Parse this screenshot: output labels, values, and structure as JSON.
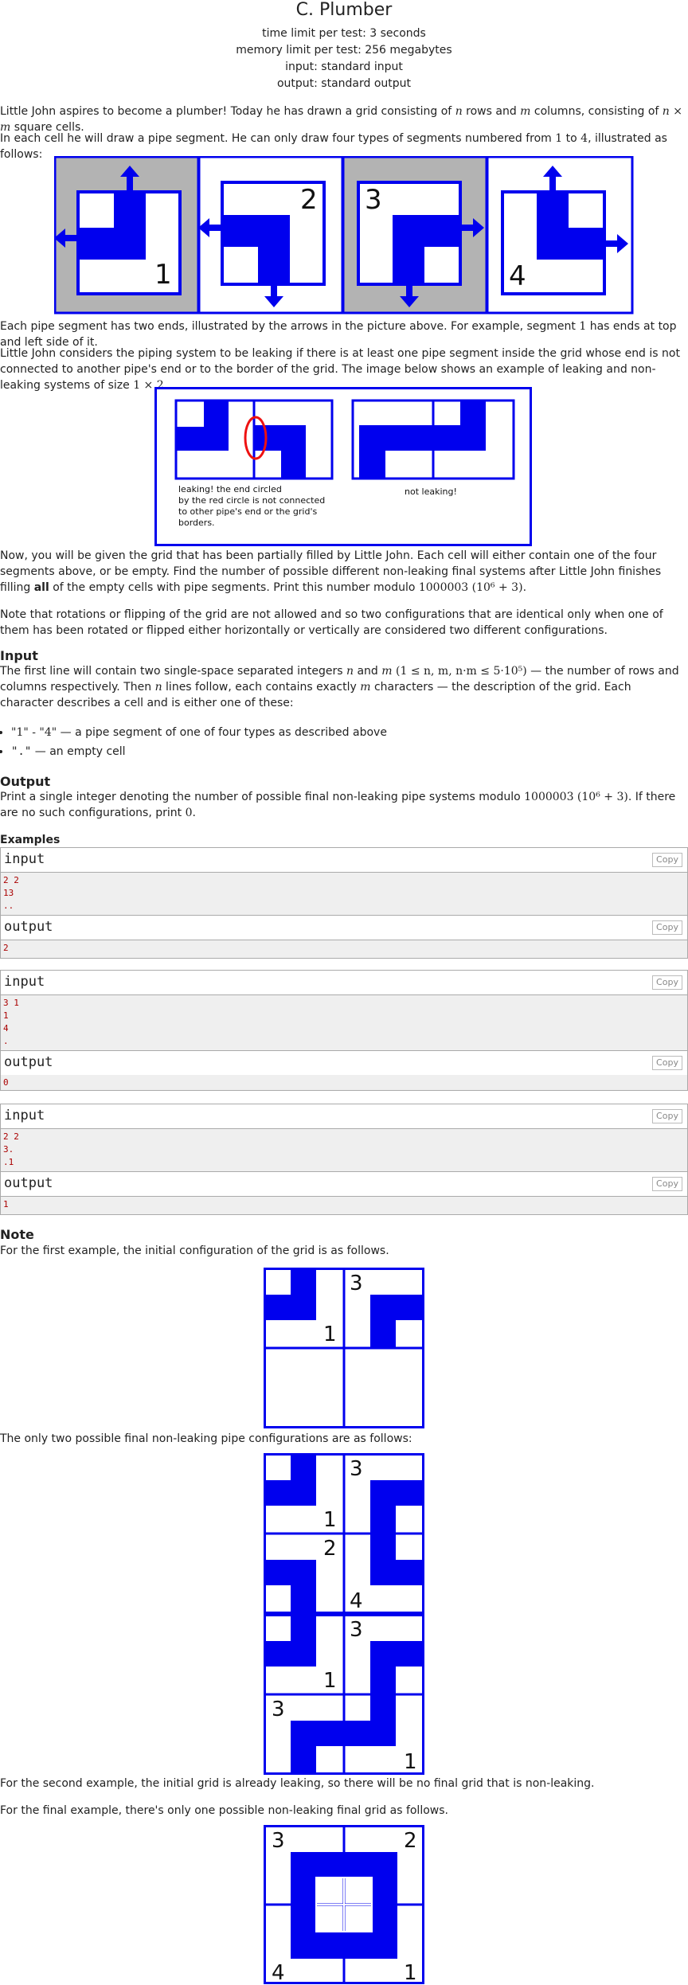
{
  "header": {
    "title": "C. Plumber",
    "time_limit": "time limit per test: 3 seconds",
    "memory_limit": "memory limit per test: 256 megabytes",
    "input": "input: standard input",
    "output": "output: standard output"
  },
  "statement": {
    "p1a": "Little John aspires to become a plumber! Today he has drawn a grid consisting of ",
    "p1n": "n",
    "p1b": " rows and ",
    "p1m": "m",
    "p1c": " columns, consisting of ",
    "p1nm": "n × m",
    "p1d": " square cells.",
    "p2a": "In each cell he will draw a pipe segment. He can only draw four types of segments numbered from ",
    "p2one": "1",
    "p2b": " to ",
    "p2four": "4",
    "p2c": ", illustrated as follows:",
    "p3a": "Each pipe segment has two ends, illustrated by the arrows in the picture above. For example, segment ",
    "p3one": "1",
    "p3b": " has ends at top and left side of it.",
    "p4a": "Little John considers the piping system to be leaking if there is at least one pipe segment inside the grid whose end is not connected to another pipe's end or to the border of the grid. The image below shows an example of leaking and non-leaking systems of size ",
    "p4size": "1 × 2",
    "p4b": ".",
    "p5a": "Now, you will be given the grid that has been partially filled by Little John. Each cell will either contain one of the four segments above, or be empty. Find the number of possible different non-leaking final systems after Little John finishes filling ",
    "p5all": "all",
    "p5b": " of the empty cells with pipe segments. Print this number modulo ",
    "p5mod": "1000003 (10⁶ + 3)",
    "p5c": ".",
    "p6": "Note that rotations or flipping of the grid are not allowed and so two configurations that are identical only when one of them has been rotated or flipped either horizontally or vertically are considered two different configurations."
  },
  "pipes": [
    "1",
    "2",
    "3",
    "4"
  ],
  "leak_figure": {
    "caption_left": [
      "leaking! the end circled",
      "by the red circle is not connected",
      "to other pipe's end or the grid's",
      "borders."
    ],
    "caption_right": "not leaking!"
  },
  "input_section": {
    "heading": "Input",
    "p1a": "The first line will contain two single-space separated integers ",
    "p1n": "n",
    "p1b": " and ",
    "p1m": "m",
    "p1c": " (1 ≤ n, m, n·m ≤ 5·10⁵)",
    "p1d": " — the number of rows and columns respectively. Then ",
    "p1n2": "n",
    "p1e": " lines follow, each contains exactly ",
    "p1m2": "m",
    "p1f": " characters — the description of the grid. Each character describes a cell and is either one of these:",
    "bullet1_code": "\"1\" - \"4\"",
    "bullet1_text": " — a pipe segment of one of four types as described above",
    "bullet2_code": "\".\"",
    "bullet2_text": " — an empty cell"
  },
  "output_section": {
    "heading": "Output",
    "p1a": "Print a single integer denoting the number of possible final non-leaking pipe systems modulo ",
    "p1mod": "1000003 (10⁶ + 3)",
    "p1b": ". If there are no such configurations, print ",
    "p1zero": "0",
    "p1c": "."
  },
  "examples": {
    "heading": "Examples",
    "input_label": "input",
    "output_label": "output",
    "copy_label": "Copy",
    "items": [
      {
        "input": "2 2\n13\n..",
        "output": "2"
      },
      {
        "input": "3 1\n1\n4\n.",
        "output": "0"
      },
      {
        "input": "2 2\n3.\n.1",
        "output": "1"
      }
    ]
  },
  "note": {
    "heading": "Note",
    "p1": "For the first example, the initial configuration of the grid is as follows.",
    "p2": "The only two possible final non-leaking pipe configurations are as follows:",
    "p3": "For the second example, the initial grid is already leaking, so there will be no final grid that is non-leaking.",
    "p4": "For the final example, there's only one possible non-leaking final grid as follows.",
    "grid1_labels": [
      "1",
      "3"
    ],
    "grid2_labels": [
      "1",
      "3",
      "2",
      "4"
    ],
    "grid3_labels": [
      "1",
      "3",
      "3",
      "1"
    ],
    "grid4_labels": [
      "3",
      "2",
      "4",
      "1"
    ]
  },
  "colors": {
    "pipe": "#0000ee",
    "gray": "#b3b3b3",
    "red": "#ee1111"
  }
}
